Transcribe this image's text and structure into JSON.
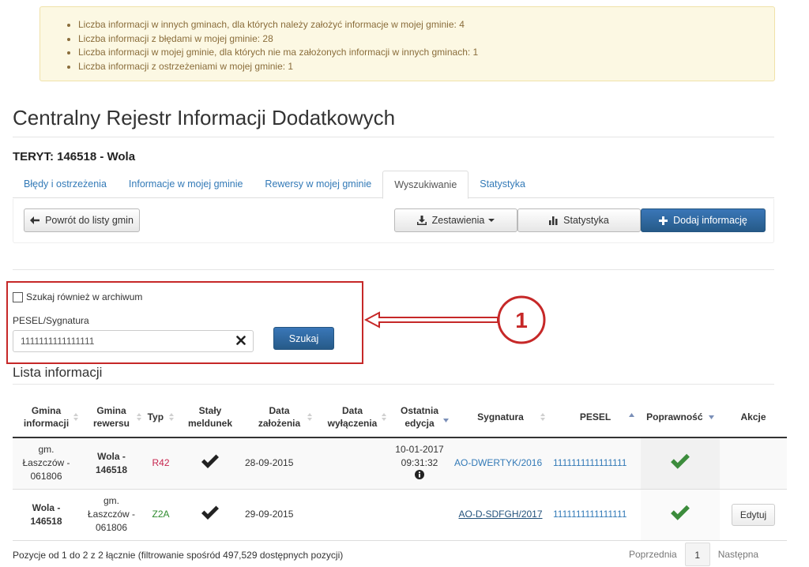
{
  "alert": {
    "items": [
      "Liczba informacji w innych gminach, dla których należy założyć informacje w mojej gminie: 4",
      "Liczba informacji z błędami w mojej gminie: 28",
      "Liczba informacji w mojej gminie, dla których nie ma założonych informacji w innych gminach: 1",
      "Liczba informacji z ostrzeżeniami w mojej gminie: 1"
    ]
  },
  "page": {
    "title": "Centralny Rejestr Informacji Dodatkowych",
    "teryt": "TERYT: 146518 - Wola"
  },
  "tabs": [
    {
      "label": "Błędy i ostrzeżenia",
      "active": false
    },
    {
      "label": "Informacje w mojej gminie",
      "active": false
    },
    {
      "label": "Rewersy w mojej gminie",
      "active": false
    },
    {
      "label": "Wyszukiwanie",
      "active": true
    },
    {
      "label": "Statystyka",
      "active": false
    }
  ],
  "toolbar": {
    "back_label": "Powrót do listy gmin",
    "reports_label": "Zestawienia",
    "stats_label": "Statystyka",
    "add_label": "Dodaj informację"
  },
  "search": {
    "archive_label": "Szukaj również w archiwum",
    "field_label": "PESEL/Sygnatura",
    "value": "1111111111111111",
    "button_label": "Szukaj",
    "callout_number": "1"
  },
  "list": {
    "title": "Lista informacji",
    "columns": {
      "gmina_informacji": [
        "Gmina",
        "informacji"
      ],
      "gmina_rewersu": [
        "Gmina",
        "rewersu"
      ],
      "typ": "Typ",
      "staly_meldunek": [
        "Stały",
        "meldunek"
      ],
      "data_zalozenia": [
        "Data",
        "założenia"
      ],
      "data_wylaczenia": [
        "Data",
        "wyłączenia"
      ],
      "ostatnia_edycja": [
        "Ostatnia",
        "edycja"
      ],
      "sygnatura": "Sygnatura",
      "pesel": "PESEL",
      "poprawnosc": "Poprawność",
      "akcje": "Akcje"
    },
    "rows": [
      {
        "gmina_informacji": [
          "gm.",
          "Łaszczów -",
          "061806"
        ],
        "gmina_rewersu": [
          "Wola -",
          "146518"
        ],
        "typ": "R42",
        "data_zalozenia": "28-09-2015",
        "ostatnia_edycja": [
          "10-01-2017",
          "09:31:32"
        ],
        "sygnatura": "AO-DWERTYK/2016",
        "pesel": "1111111111111111"
      },
      {
        "gmina_informacji": [
          "Wola -",
          "146518"
        ],
        "gmina_rewersu": [
          "gm.",
          "Łaszczów -",
          "061806"
        ],
        "typ": "Z2A",
        "data_zalozenia": "29-09-2015",
        "sygnatura": "AO-D-SDFGH/2017",
        "pesel": "1111111111111111",
        "action_label": "Edytuj"
      }
    ]
  },
  "footer": {
    "summary": "Pozycje od 1 do 2 z 2 łącznie (filtrowanie spośród 497,529 dostępnych pozycji)",
    "prev_label": "Poprzednia",
    "current_page": "1",
    "next_label": "Następna"
  },
  "icons": {
    "back": "arrow-left-icon",
    "download": "download-icon",
    "stats": "bar-chart-icon",
    "add": "plus-icon",
    "clear": "times-icon",
    "info": "info-circle-icon",
    "check": "check-icon"
  },
  "colors": {
    "alert_bg": "#fcf8e3",
    "primary": "#2e6da4",
    "link": "#337ab7",
    "callout": "#c62828",
    "check_ok": "#3c8c3c",
    "typ_r": "#c7254e",
    "typ_z": "#2e8b2e"
  }
}
